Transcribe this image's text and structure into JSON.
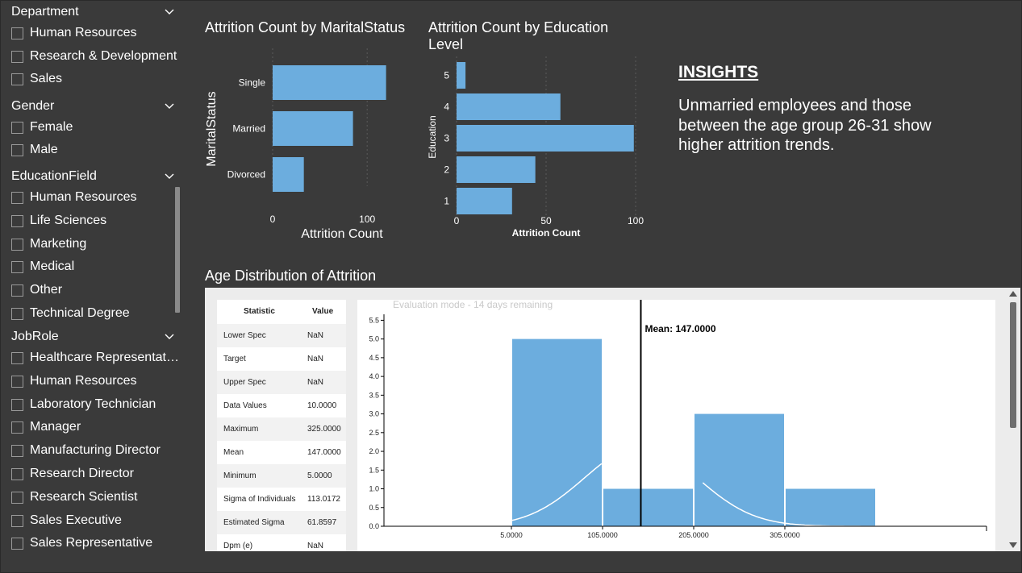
{
  "slicers": {
    "department": {
      "title": "Department",
      "items": [
        "Human Resources",
        "Research & Development",
        "Sales"
      ]
    },
    "gender": {
      "title": "Gender",
      "items": [
        "Female",
        "Male"
      ]
    },
    "education_field": {
      "title": "EducationField",
      "items": [
        "Human Resources",
        "Life Sciences",
        "Marketing",
        "Medical",
        "Other",
        "Technical Degree"
      ]
    },
    "job_role": {
      "title": "JobRole",
      "items": [
        "Healthcare Representat…",
        "Human Resources",
        "Laboratory Technician",
        "Manager",
        "Manufacturing Director",
        "Research Director",
        "Research Scientist",
        "Sales Executive",
        "Sales Representative"
      ]
    }
  },
  "marital_chart": {
    "title": "Attrition Count by MaritalStatus"
  },
  "education_chart": {
    "title_line1": "Attrition Count by Education",
    "title_line2": "Level"
  },
  "insights": {
    "heading": "INSIGHTS",
    "text": "Unmarried employees and those between the age group 26-31 show higher attrition trends."
  },
  "age_chart": {
    "title": "Age Distribution of Attrition",
    "watermark": "Evaluation mode - 14 days remaining",
    "mean_label": "Mean: 147.0000",
    "table_headers": [
      "Statistic",
      "Value"
    ],
    "stats": [
      [
        "Lower Spec",
        "NaN"
      ],
      [
        "Target",
        "NaN"
      ],
      [
        "Upper Spec",
        "NaN"
      ],
      [
        "Data Values",
        "10.0000"
      ],
      [
        "Maximum",
        "325.0000"
      ],
      [
        "Mean",
        "147.0000"
      ],
      [
        "Minimum",
        "5.0000"
      ],
      [
        "Sigma of Individuals",
        "113.0172"
      ],
      [
        "Estimated Sigma",
        "61.8597"
      ],
      [
        "Dpm (e)",
        "NaN"
      ]
    ]
  },
  "colors": {
    "bar": "#6cadde",
    "background": "#3a3a3a",
    "mean_line": "#000000",
    "curve": "#ffffff"
  },
  "chart_data": [
    {
      "type": "bar",
      "orientation": "horizontal",
      "categories": [
        "Single",
        "Married",
        "Divorced"
      ],
      "values": [
        120,
        85,
        33
      ],
      "xlabel": "Attrition Count",
      "ylabel": "MaritalStatus",
      "xlim": [
        0,
        128
      ],
      "xticks": [
        "0",
        "100"
      ],
      "grid": true
    },
    {
      "type": "bar",
      "orientation": "horizontal",
      "categories": [
        "5",
        "4",
        "3",
        "2",
        "1"
      ],
      "values": [
        5,
        58,
        99,
        44,
        31
      ],
      "xlabel": "Attrition Count",
      "ylabel": "Education",
      "xlim": [
        0,
        100
      ],
      "xticks": [
        "0",
        "50",
        "100"
      ],
      "grid": true
    },
    {
      "type": "bar",
      "subtype": "histogram",
      "bins": [
        [
          5,
          105
        ],
        [
          105,
          205
        ],
        [
          205,
          305
        ],
        [
          305,
          405
        ]
      ],
      "values": [
        5,
        1,
        3,
        1
      ],
      "xticks": [
        "5.0000",
        "105.0000",
        "205.0000",
        "305.0000"
      ],
      "yticks": [
        "0.0",
        "0.5",
        "1.0",
        "1.5",
        "2.0",
        "2.5",
        "3.0",
        "3.5",
        "4.0",
        "4.5",
        "5.0",
        "5.5"
      ],
      "ylim": [
        0,
        5.5
      ],
      "mean": 147,
      "mean_label": "Mean: 147.0000"
    }
  ]
}
